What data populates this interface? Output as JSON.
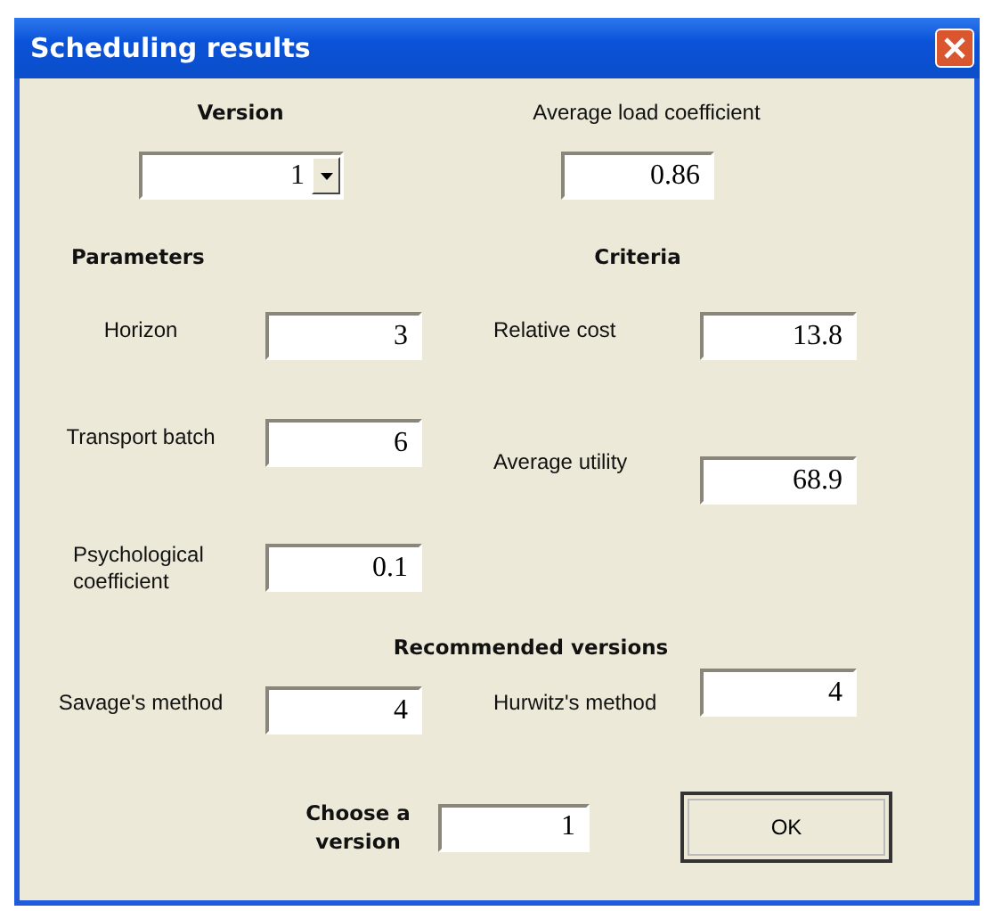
{
  "window": {
    "title": "Scheduling results"
  },
  "version": {
    "label": "Version",
    "value": "1"
  },
  "average_load": {
    "label": "Average load coefficient",
    "value": "0.86"
  },
  "parameters": {
    "heading": "Parameters",
    "fields": [
      {
        "label": "Horizon",
        "value": "3"
      },
      {
        "label": "Transport batch",
        "value": "6"
      },
      {
        "label": "Psychological coefficient",
        "value": "0.1"
      }
    ]
  },
  "criteria": {
    "heading": "Criteria",
    "fields": [
      {
        "label": "Relative cost",
        "value": "13.8"
      },
      {
        "label": "Average utility",
        "value": "68.9"
      }
    ]
  },
  "recommended": {
    "heading": "Recommended versions",
    "fields": [
      {
        "label": "Savage's method",
        "value": "4"
      },
      {
        "label": "Hurwitz's method",
        "value": "4"
      }
    ]
  },
  "choose": {
    "label": "Choose a version",
    "value": "1"
  },
  "buttons": [
    "OK"
  ]
}
